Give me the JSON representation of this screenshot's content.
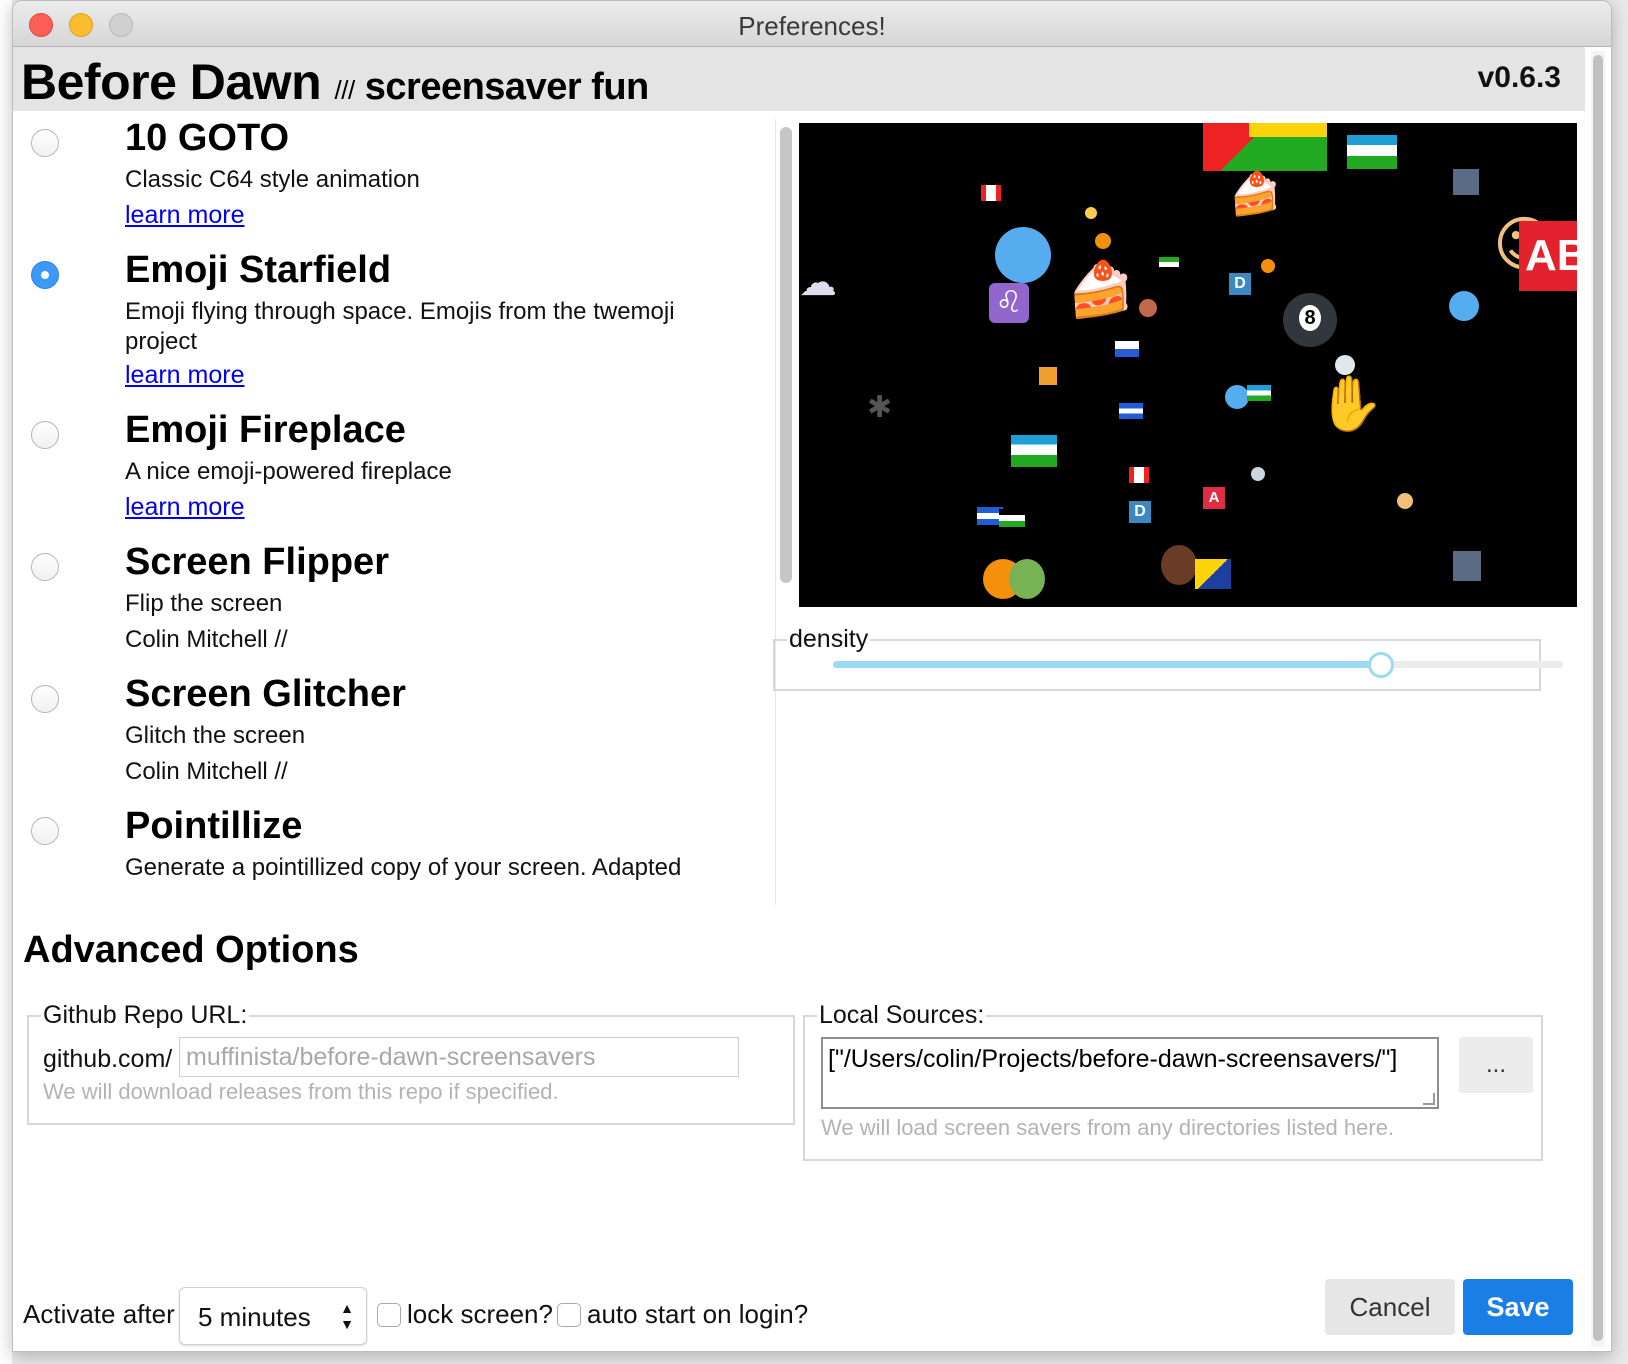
{
  "window": {
    "title": "Preferences!"
  },
  "header": {
    "app_name": "Before Dawn",
    "separator": "///",
    "tagline": "screensaver fun",
    "version": "v0.6.3"
  },
  "savers": [
    {
      "name": "10 GOTO",
      "description": "Classic C64 style animation",
      "link": "learn more",
      "selected": false
    },
    {
      "name": "Emoji Starfield",
      "description_lines": [
        "Emoji flying through space. Emojis from the twemoji",
        "project"
      ],
      "link": "learn more",
      "selected": true
    },
    {
      "name": "Emoji Fireplace",
      "description": "A nice emoji-powered fireplace",
      "link": "learn more",
      "selected": false
    },
    {
      "name": "Screen Flipper",
      "description": "Flip the screen",
      "author": "Colin Mitchell //",
      "selected": false
    },
    {
      "name": "Screen Glitcher",
      "description": "Glitch the screen",
      "author": "Colin Mitchell //",
      "selected": false
    },
    {
      "name": "Pointillize",
      "description": "Generate a pointillized copy of your screen. Adapted",
      "selected": false
    }
  ],
  "preview": {
    "density_label": "density",
    "density_value": 0.75,
    "emoji_text": {
      "ab": "AB",
      "a": "A",
      "d": "D",
      "eight": "8"
    }
  },
  "advanced": {
    "title": "Advanced Options",
    "repo": {
      "legend": "Github Repo URL:",
      "prefix": "github.com/",
      "placeholder": "muffinista/before-dawn-screensavers",
      "hint": "We will download releases from this repo if specified."
    },
    "local": {
      "legend": "Local Sources:",
      "value": "[\"/Users/colin/Projects/before-dawn-screensavers/\"]",
      "browse_label": "...",
      "hint": "We will load screen savers from any directories listed here."
    }
  },
  "footer": {
    "activate_label": "Activate after",
    "activate_value": "5 minutes",
    "lock_label": "lock screen?",
    "lock_checked": false,
    "autostart_label": "auto start on login?",
    "autostart_checked": false,
    "cancel_label": "Cancel",
    "save_label": "Save"
  }
}
